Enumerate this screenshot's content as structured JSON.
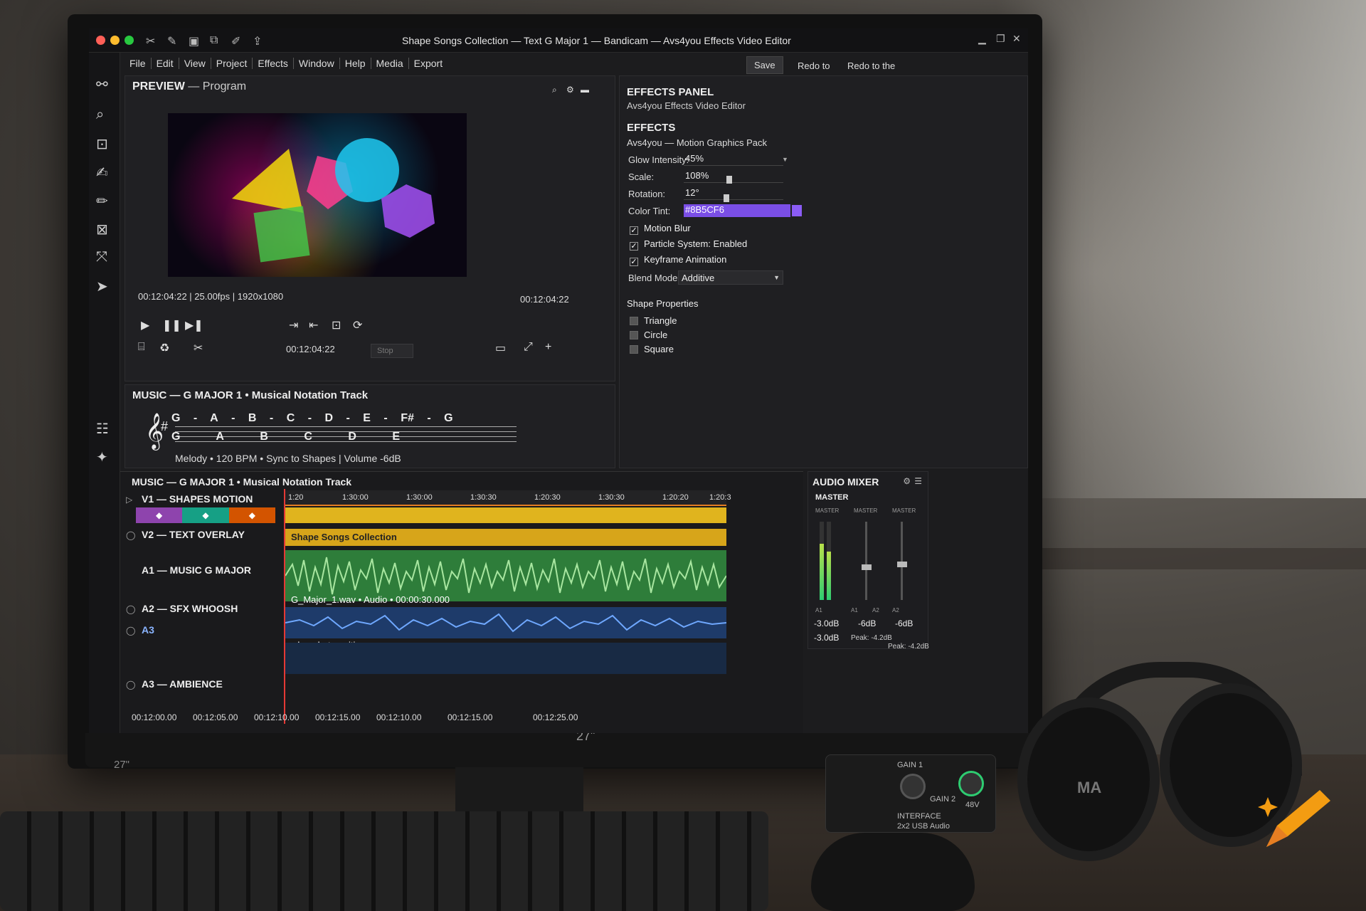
{
  "window": {
    "title": "Shape Songs Collection — Text G Major 1 — Bandicam — Avs4you Effects Video Editor"
  },
  "menu": [
    "File",
    "Edit",
    "View",
    "Project",
    "Effects",
    "Window",
    "Help",
    "Media",
    "Export"
  ],
  "preview": {
    "head": "PREVIEW",
    "head_sub": "— Program",
    "timecode_info": "00:12:04:22 | 25.00fps | 1920x1080",
    "timecode_right": "00:12:04:22",
    "timecode_mid": "00:12:04:22",
    "stop_label": "Stop"
  },
  "music": {
    "head": "MUSIC — G MAJOR 1 • Musical Notation Track",
    "notes_top": [
      "G",
      "-",
      "A",
      "-",
      "B",
      "-",
      "C",
      "-",
      "D",
      "-",
      "E",
      "-",
      "F#",
      "-",
      "G"
    ],
    "notes_bottom": [
      "G",
      "A",
      "B",
      "C",
      "D",
      "E"
    ],
    "info": "Melody • 120 BPM • Sync to Shapes | Volume -6dB"
  },
  "effects": {
    "title": "EFFECTS PANEL",
    "subtitle": "Avs4you Effects Video Editor",
    "save": "Save",
    "redo_to": "Redo to",
    "redo_to_the": "Redo to the",
    "section": "EFFECTS",
    "pack": "Avs4you — Motion Graphics Pack",
    "glow_label": "Glow Intensity:",
    "glow_value": "45%",
    "scale_label": "Scale:",
    "scale_value": "108%",
    "rotation_label": "Rotation:",
    "rotation_value": "12°",
    "tint_label": "Color Tint:",
    "tint_value": "#8B5CF6",
    "motion_blur": "Motion Blur",
    "particle": "Particle System: Enabled",
    "keyframe": "Keyframe Animation",
    "blend_label": "Blend Mode:",
    "blend_value": "Additive",
    "shape_props": "Shape Properties",
    "triangle": "Triangle",
    "circle": "Circle",
    "square": "Square"
  },
  "timeline": {
    "head": "MUSIC — G MAJOR 1 • Musical Notation Track",
    "tracks": {
      "v1": "V1 — SHAPES MOTION",
      "v2": "V2 — TEXT OVERLAY",
      "a1": "A1 — MUSIC G MAJOR",
      "a2": "A2 — SFX WHOOSH",
      "a3_short": "A3",
      "a3": "A3 — AMBIENCE"
    },
    "ruler": [
      "1:20",
      "1:30:00",
      "1:30:00",
      "1:30:30",
      "1:20:30",
      "1:30:30",
      "1:20:20",
      "1:20:3"
    ],
    "clip_text": "Shape Songs Collection",
    "audio_caption": "G_Major_1.wav • Audio • 00:00:30.000",
    "sfx_caption": "whoosh_transition.wav",
    "bottom_ruler": [
      "00:12:00.00",
      "00:12:05.00",
      "00:12:10.00",
      "00:12:15.00",
      "00:12:10.00",
      "00:12:15.00",
      "00:12:25.00"
    ]
  },
  "mixer": {
    "title": "AUDIO MIXER",
    "master": "MASTER",
    "channels": [
      "MASTER",
      "MASTER",
      "MASTER"
    ],
    "ch_bottom": [
      "A1",
      "A1",
      "A2",
      "A2"
    ],
    "db1": "-3.0dB",
    "db2": "-6dB",
    "db3": "-6dB",
    "db_bottom": "-3.0dB",
    "peak1": "Peak: -4.2dB",
    "peak2": "Peak: -4.2dB",
    "levels": [
      0.72,
      0.62
    ]
  },
  "hardware": {
    "monitor_size": "27\"",
    "monitor_corner": "27\"",
    "usb_gain1": "GAIN 1",
    "usb_gain2": "GAIN 2",
    "usb_48v": "48V",
    "usb_desc": "2x2 USB Audio",
    "usb_interface": "INTERFACE",
    "headphone_brand": "MA"
  },
  "colors": {
    "accent": "#e67e22",
    "tint": "#8B5CF6",
    "clip_yellow": "#e0b41e",
    "wave_green": "#2e7d3a",
    "wave_blue": "#1e3b6a"
  }
}
